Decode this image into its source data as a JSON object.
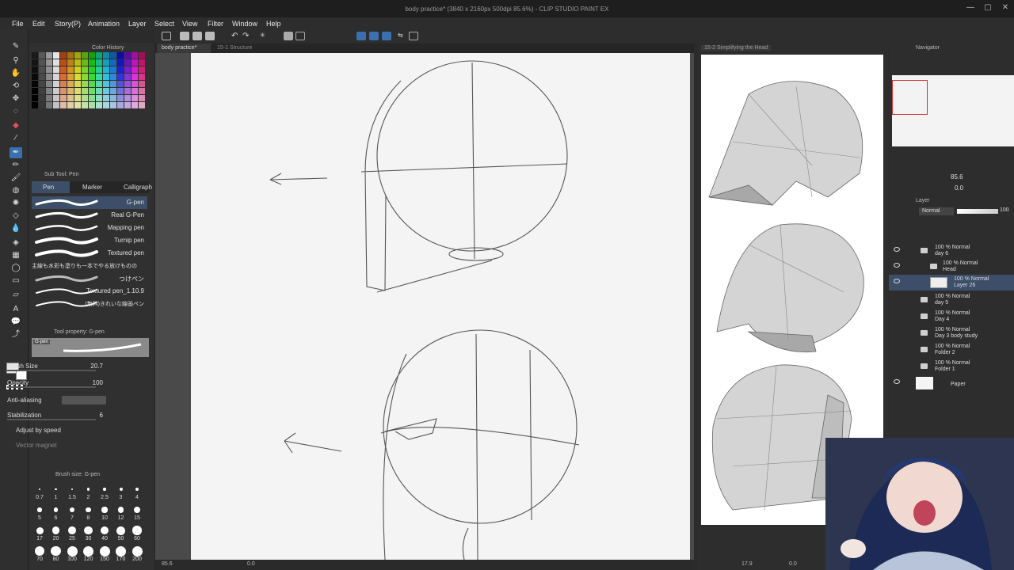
{
  "window": {
    "title": "body practice* (3840 x 2160px 500dpi 85.6%)  - CLIP STUDIO PAINT EX",
    "controls": [
      "—",
      "▢",
      "✕"
    ]
  },
  "menu": [
    "File",
    "Edit",
    "Story(P)",
    "Animation",
    "Layer",
    "Select",
    "View",
    "Filter",
    "Window",
    "Help"
  ],
  "panels": {
    "color_history": "Color History",
    "sub_tool": "Sub Tool: Pen",
    "tool_property": "Tool property: G-pen",
    "brush_size_panel": "Brush size: G-pen",
    "navigator": "Navigator",
    "layer": "Layer"
  },
  "subtool_tabs": [
    "Pen",
    "Marker",
    "Calligraph"
  ],
  "brushes": [
    "G-pen",
    "Real G-Pen",
    "Mapping pen",
    "Turnip pen",
    "Textured pen",
    "主線も水彩も塗りも一本でやる放けものの",
    "つけペン",
    "Textured pen_1.10.9",
    "(無料)きれいな線画ペン"
  ],
  "tool_property": {
    "preview_label": "G-pen",
    "brush_size_label": "Brush Size",
    "brush_size_value": "20.7",
    "opacity_label": "Opacity",
    "opacity_value": "100",
    "antialias_label": "Anti-aliasing",
    "stabilization_label": "Stabilization",
    "stabilization_value": "6",
    "adjust_speed_label": "Adjust by speed",
    "vector_magnet_label": "Vector magnet"
  },
  "brush_sizes": [
    "0.7",
    "1",
    "1.5",
    "2",
    "2.5",
    "3",
    "4",
    "5",
    "6",
    "7",
    "8",
    "10",
    "12",
    "15",
    "17",
    "20",
    "25",
    "30",
    "40",
    "50",
    "60",
    "70",
    "80",
    "100",
    "120",
    "150",
    "170",
    "200"
  ],
  "doc_tabs": [
    "body practice*",
    "15-1 Structure"
  ],
  "reference_tab": "15-2 Simplifying the Head",
  "navigator": {
    "zoom": "85.6",
    "rotation": "0.0"
  },
  "layer_panel": {
    "blend_mode": "Normal",
    "opacity": "100",
    "layers": [
      {
        "mode": "100 % Normal",
        "name": "day 6"
      },
      {
        "mode": "100 % Normal",
        "name": "Head"
      },
      {
        "mode": "100 % Normal",
        "name": "Layer 26"
      },
      {
        "mode": "100 % Normal",
        "name": "day 5"
      },
      {
        "mode": "100 % Normal",
        "name": "Day 4"
      },
      {
        "mode": "100 % Normal",
        "name": "Day 3 body study"
      },
      {
        "mode": "100 % Normal",
        "name": "Folder 2"
      },
      {
        "mode": "100 % Normal",
        "name": "Folder 1"
      },
      {
        "mode": "",
        "name": "Paper"
      }
    ]
  },
  "status": {
    "zoom": "85.6",
    "angle": "0.0",
    "ref_zoom": "17.9",
    "ref_angle": "0.0"
  },
  "colors": {
    "accent": "#3b6fb0",
    "selected_row": "#3c4e68"
  }
}
